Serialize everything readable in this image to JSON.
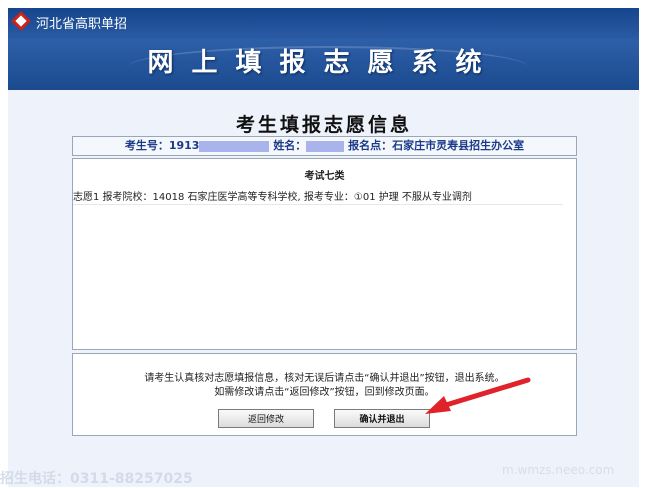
{
  "header": {
    "site_name": "河北省高职单招",
    "system_title": "网上填报志愿系统"
  },
  "page": {
    "title": "考生填报志愿信息"
  },
  "info_bar": {
    "exam_no_label": "考生号：",
    "exam_no_value": "1913",
    "name_label": "姓名：",
    "site_label": "报名点：",
    "site_value": "石家庄市灵寿县招生办公室"
  },
  "content": {
    "exam_type": "考试七类",
    "choice": "志愿1 报考院校：14018 石家庄医学高等专科学校, 报考专业：①01 护理 不服从专业调剂"
  },
  "notice": {
    "line1": "请考生认真核对志愿填报信息，核对无误后请点击“确认并退出”按钮，退出系统。",
    "line2": "如需修改请点击“返回修改”按钮，回到修改页面。"
  },
  "buttons": {
    "back": "返回修改",
    "confirm": "确认并退出"
  },
  "footer": {
    "left": "招生电话：0311-88257025",
    "right": "m.wmzs.neeo.com"
  },
  "colors": {
    "header_blue": "#1c4f9a",
    "accent_text": "#1a3b8a",
    "arrow_red": "#e0222a"
  }
}
